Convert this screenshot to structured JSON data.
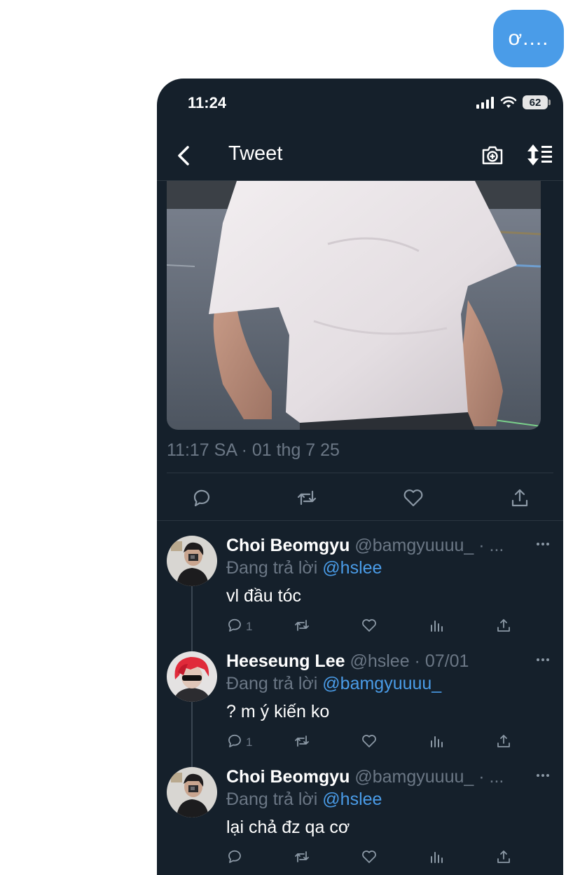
{
  "chat": {
    "bubble_text": "ơ...."
  },
  "status_bar": {
    "time": "11:24",
    "battery": "62"
  },
  "nav": {
    "title": "Tweet"
  },
  "tweet": {
    "timestamp": "11:17 SA · 01 thg 7 25"
  },
  "replies": [
    {
      "name": "Choi Beomgyu",
      "handle": "@bamgyuuuu_ · ...",
      "replying_prefix": "Đang trả lời ",
      "replying_to": "@hslee",
      "text": "vl đầu tóc",
      "reply_count": "1"
    },
    {
      "name": "Heeseung Lee",
      "handle": "@hslee · 07/01",
      "replying_prefix": "Đang trả lời ",
      "replying_to": "@bamgyuuuu_",
      "text": "? m ý kiến ko",
      "reply_count": "1"
    },
    {
      "name": "Choi Beomgyu",
      "handle": "@bamgyuuuu_ · ...",
      "replying_prefix": "Đang trả lời ",
      "replying_to": "@hslee",
      "text": "lại chả đz qa cơ",
      "reply_count": ""
    }
  ],
  "colors": {
    "bubble": "#4a9ce8",
    "background": "#15202b",
    "secondary_text": "#6b7785",
    "link": "#4a9ce8"
  },
  "icons": [
    "back-chevron-icon",
    "camera-plus-icon",
    "sort-icon",
    "reply-icon",
    "retweet-icon",
    "like-icon",
    "share-icon",
    "analytics-icon",
    "more-icon"
  ]
}
